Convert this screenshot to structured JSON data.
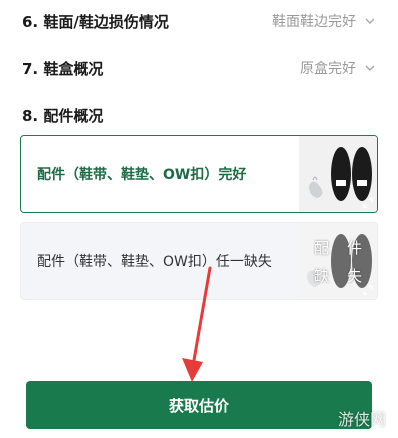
{
  "rows": [
    {
      "title": "6. 鞋面/鞋边损伤情况",
      "value": "鞋面鞋边完好"
    },
    {
      "title": "7. 鞋盒概况",
      "value": "原盒完好"
    }
  ],
  "section8": {
    "title": "8. 配件概况"
  },
  "options": [
    {
      "label": "配件（鞋带、鞋垫、OW扣）完好",
      "selected": true
    },
    {
      "label": "配件（鞋带、鞋垫、OW扣）任一缺失",
      "selected": false,
      "overlay": [
        "配",
        "件",
        "缺",
        "失"
      ]
    }
  ],
  "cta": {
    "label": "获取估价"
  },
  "watermark": "游侠网",
  "colors": {
    "accent": "#197a4d",
    "arrow": "#e63b3b"
  }
}
